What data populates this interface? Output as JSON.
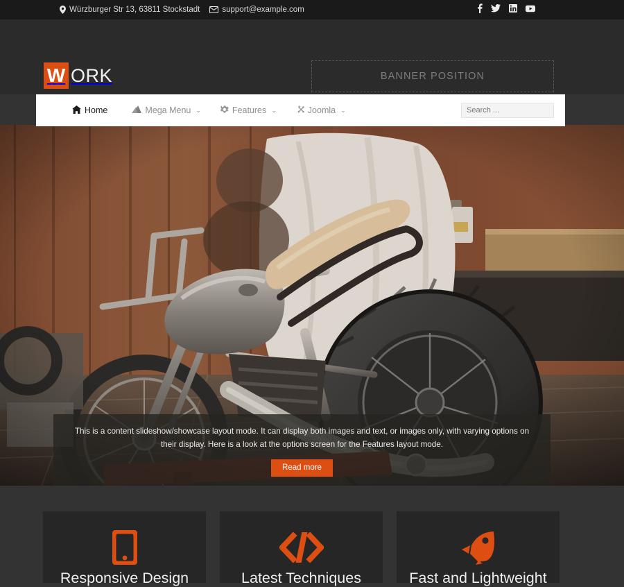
{
  "topbar": {
    "address": "Würzburger Str 13, 63811 Stockstadt",
    "email": "support@example.com",
    "address_icon": "map-pin-icon",
    "email_icon": "envelope-icon",
    "social": [
      {
        "name": "facebook-icon",
        "label": "Facebook"
      },
      {
        "name": "twitter-icon",
        "label": "Twitter"
      },
      {
        "name": "linkedin-icon",
        "label": "LinkedIn"
      },
      {
        "name": "youtube-icon",
        "label": "YouTube"
      }
    ]
  },
  "header": {
    "logo_mark": "W",
    "logo_text": "ORK",
    "banner_label": "BANNER POSITION",
    "accent_color": "#dd4e12",
    "bg_color": "#2b2b2b"
  },
  "nav": {
    "items": [
      {
        "label": "Home",
        "icon": "home-icon",
        "active": true,
        "caret": ""
      },
      {
        "label": "Mega Menu",
        "icon": "mountain-icon",
        "active": false,
        "caret": "⌄"
      },
      {
        "label": "Features",
        "icon": "gear-icon",
        "active": false,
        "caret": "⌄"
      },
      {
        "label": "Joomla",
        "icon": "joomla-icon",
        "active": false,
        "caret": "⌄"
      }
    ],
    "search": {
      "placeholder": "Search ...",
      "value": "",
      "icon": "search-icon"
    }
  },
  "hero": {
    "image_description": "Vintage cafe racer motorcycle in a wooden garage workshop",
    "caption_text": "This is a content slideshow/showcase layout mode. It can display both images and text, or images only, with varying options on their display. Here is a look at the options screen for the Features layout mode.",
    "button_label": "Read more"
  },
  "features": {
    "cards": [
      {
        "title": "Responsive Design",
        "icon": "mobile-phone-icon"
      },
      {
        "title": "Latest Techniques",
        "icon": "code-brackets-icon"
      },
      {
        "title": "Fast and Lightweight",
        "icon": "rocket-icon"
      }
    ]
  }
}
